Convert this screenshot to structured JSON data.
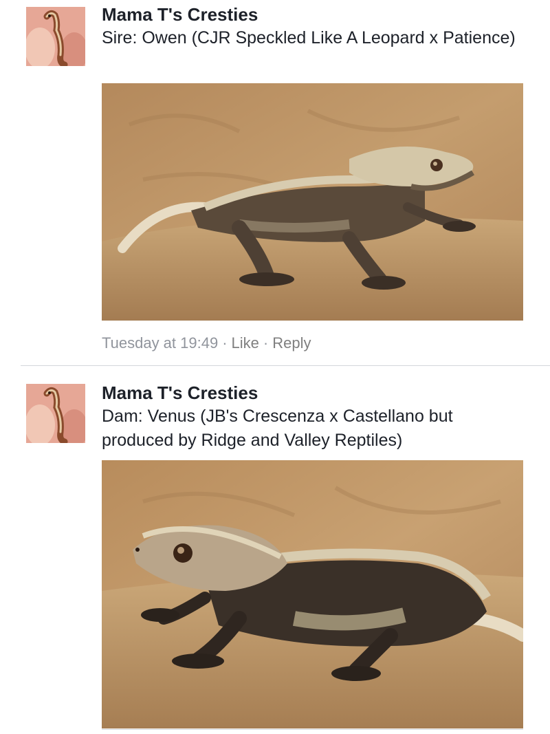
{
  "comments": [
    {
      "author": "Mama T's Cresties",
      "text": "Sire: Owen (CJR Speckled Like A Leopard x Patience)",
      "timestamp": "Tuesday at 19:49",
      "like_label": "Like",
      "reply_label": "Reply",
      "separator": "·"
    },
    {
      "author": "Mama T's Cresties",
      "text": "Dam:  Venus (JB's Crescenza x Castellano but produced by Ridge and Valley Reptiles)"
    }
  ],
  "icons": {
    "avatar": "gecko-avatar-icon"
  },
  "colors": {
    "author": "#1d2129",
    "meta": "#90949c",
    "photo_background": "#b58d5f"
  }
}
